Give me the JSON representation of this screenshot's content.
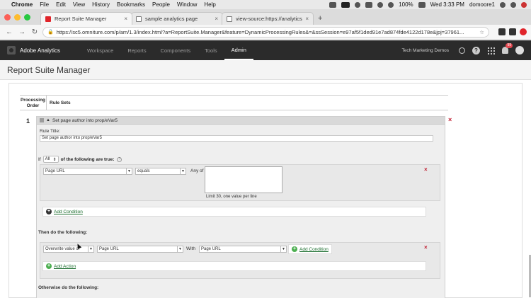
{
  "menubar": {
    "app": "Chrome",
    "items": [
      "File",
      "Edit",
      "View",
      "History",
      "Bookmarks",
      "People",
      "Window",
      "Help"
    ],
    "battery": "100%",
    "clock": "Wed 3:33 PM",
    "user": "domoore1"
  },
  "browser": {
    "tabs": [
      {
        "label": "Report Suite Manager",
        "favicon": "adobe-icon"
      },
      {
        "label": "sample analytics page",
        "favicon": "page-icon"
      },
      {
        "label": "view-source:https://analytics.",
        "favicon": "page-icon"
      }
    ],
    "url": "https://sc5.omniture.com/p/am/1.3/index.html?a=ReportSuite.Manager&feature=DynamicProcessingRules&=&ssSession=e97af5f1ded91e7ad874fde4122d178e&jpj=37961..."
  },
  "app_header": {
    "product": "Adobe Analytics",
    "nav": [
      "Workspace",
      "Reports",
      "Components",
      "Tools",
      "Admin"
    ],
    "active_nav": "Admin",
    "org": "Tech Marketing Demos",
    "notification_count": "99"
  },
  "page": {
    "title": "Report Suite Manager",
    "table": {
      "col_order_line1": "Processing",
      "col_order_line2": "Order",
      "col_rulesets": "Rule Sets"
    },
    "rule": {
      "number": "1",
      "header_title": "Set page author into prop/eVar5",
      "title_label": "Rule Title:",
      "title_value": "Set page author into prop/eVar5",
      "if_label": "If",
      "if_mode": "All",
      "if_suffix": "of the following are true:",
      "condition": {
        "field": "Page URL",
        "operator": "equals",
        "any_of_label": "Any of",
        "limit_hint": "Limit 30, one value per line"
      },
      "add_condition": "Add Condition",
      "then_label": "Then do the following:",
      "action": {
        "type": "Overwrite value of",
        "target": "Page URL",
        "with_label": "With",
        "source": "Page URL",
        "add_condition": "Add Condition"
      },
      "add_action": "Add Action",
      "otherwise_label": "Otherwise do the following:"
    }
  }
}
